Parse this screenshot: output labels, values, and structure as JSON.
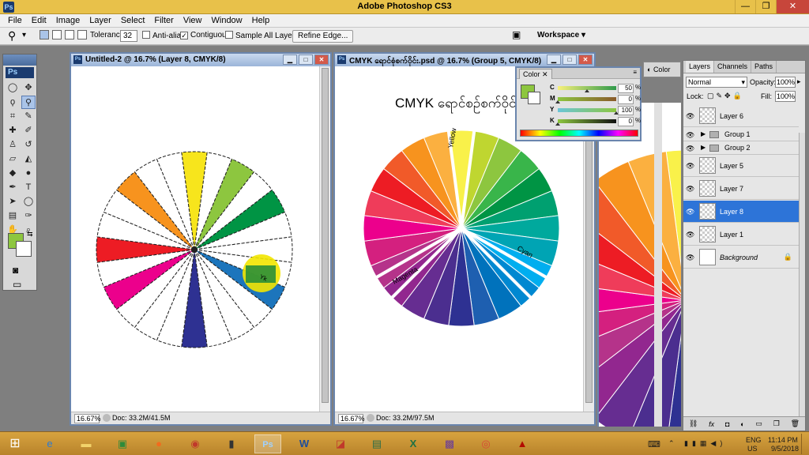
{
  "app": {
    "title": "Adobe Photoshop CS3",
    "logo": "Ps",
    "window_buttons": [
      "—",
      "❐",
      "✕"
    ]
  },
  "menu": [
    "File",
    "Edit",
    "Image",
    "Layer",
    "Select",
    "Filter",
    "View",
    "Window",
    "Help"
  ],
  "options": {
    "tolerance_label": "Tolerance:",
    "tolerance_value": "32",
    "anti_alias": "Anti-alias",
    "contiguous": "Contiguous",
    "sample_all_layers": "Sample All Layers",
    "refine_edge": "Refine Edge...",
    "workspace": "Workspace ▾"
  },
  "doc1": {
    "title": "Untitled-2 @ 16.7% (Layer 8, CMYK/8)",
    "zoom": "16.67%",
    "doc_info": "Doc: 33.2M/41.5M",
    "wheel_colors": [
      "#f7e51c",
      "#ffffff",
      "#8dc63f",
      "#ffffff",
      "#009444",
      "#ffffff",
      "#ffffff",
      "#ffffff",
      "#1c75bc",
      "#ffffff",
      "#ffffff",
      "#ffffff",
      "#2e3192",
      "#ffffff",
      "#ffffff",
      "#ffffff",
      "#ec008c",
      "#ffffff",
      "#ed1c24",
      "#ffffff",
      "#ffffff",
      "#f7931e",
      "#ffffff",
      "#ffffff"
    ],
    "circle_label": "Yk"
  },
  "doc2": {
    "title": "CMYK ရောင်စုံစက်ဝိုင်း.psd @ 16.7% (Group 5, CMYK/8)",
    "heading": "CMYK ရောင်စဉ်စက်ဝိုင်",
    "zoom": "16.67%",
    "doc_info": "Doc: 33.2M/97.5M",
    "wheel_colors": [
      "#f9f14a",
      "#bfd630",
      "#8dc63f",
      "#39b54a",
      "#009444",
      "#00a070",
      "#00a99d",
      "#00a4b4",
      "#00aeef",
      "#0088d1",
      "#0072bc",
      "#1e5fb0",
      "#2e3192",
      "#4b2e8f",
      "#662d91",
      "#92278f",
      "#b5338a",
      "#d4207f",
      "#ec008c",
      "#ef3c5a",
      "#ed1c24",
      "#f15a29",
      "#f7931e",
      "#fbb040"
    ],
    "labels": {
      "yellow": "Yellow",
      "cyan": "Cyan",
      "magenta": "Magenta"
    }
  },
  "color_panel": {
    "tab": "Color",
    "swatch_fg": "#8dc63f",
    "rows": [
      {
        "label": "C",
        "value": "50",
        "pct": "%",
        "level": 0.5
      },
      {
        "label": "M",
        "value": "0",
        "pct": "%",
        "level": 0.0
      },
      {
        "label": "Y",
        "value": "100",
        "pct": "%",
        "level": 1.0
      },
      {
        "label": "K",
        "value": "0",
        "pct": "%",
        "level": 0.0
      }
    ]
  },
  "dock_color_btn": "Color",
  "layers_panel": {
    "tabs": [
      "Layers",
      "Channels",
      "Paths"
    ],
    "blend_mode": "Normal",
    "opacity_label": "Opacity:",
    "opacity_value": "100%",
    "lock_label": "Lock:",
    "fill_label": "Fill:",
    "fill_value": "100%",
    "layers": [
      {
        "name": "Layer 6",
        "type": "layer"
      },
      {
        "name": "Group 1",
        "type": "group"
      },
      {
        "name": "Group 2",
        "type": "group"
      },
      {
        "name": "Layer 5",
        "type": "layer"
      },
      {
        "name": "Layer 7",
        "type": "layer"
      },
      {
        "name": "Layer 8",
        "type": "layer",
        "selected": true
      },
      {
        "name": "Layer 1",
        "type": "layer"
      },
      {
        "name": "Background",
        "type": "background"
      }
    ],
    "bottom_icons": [
      "link-icon",
      "fx-icon",
      "mask-icon",
      "adjustment-icon",
      "group-icon",
      "new-layer-icon",
      "trash-icon"
    ]
  },
  "taskbar": {
    "apps": [
      "start",
      "ie",
      "explorer",
      "excel-store",
      "firefox",
      "media",
      "usb",
      "photoshop",
      "word",
      "pdf",
      "presentation",
      "excel",
      "picture",
      "chrome",
      "acrobat"
    ],
    "lang": "ENG",
    "region": "US",
    "time": "11:14 PM",
    "date": "9/5/2018"
  }
}
